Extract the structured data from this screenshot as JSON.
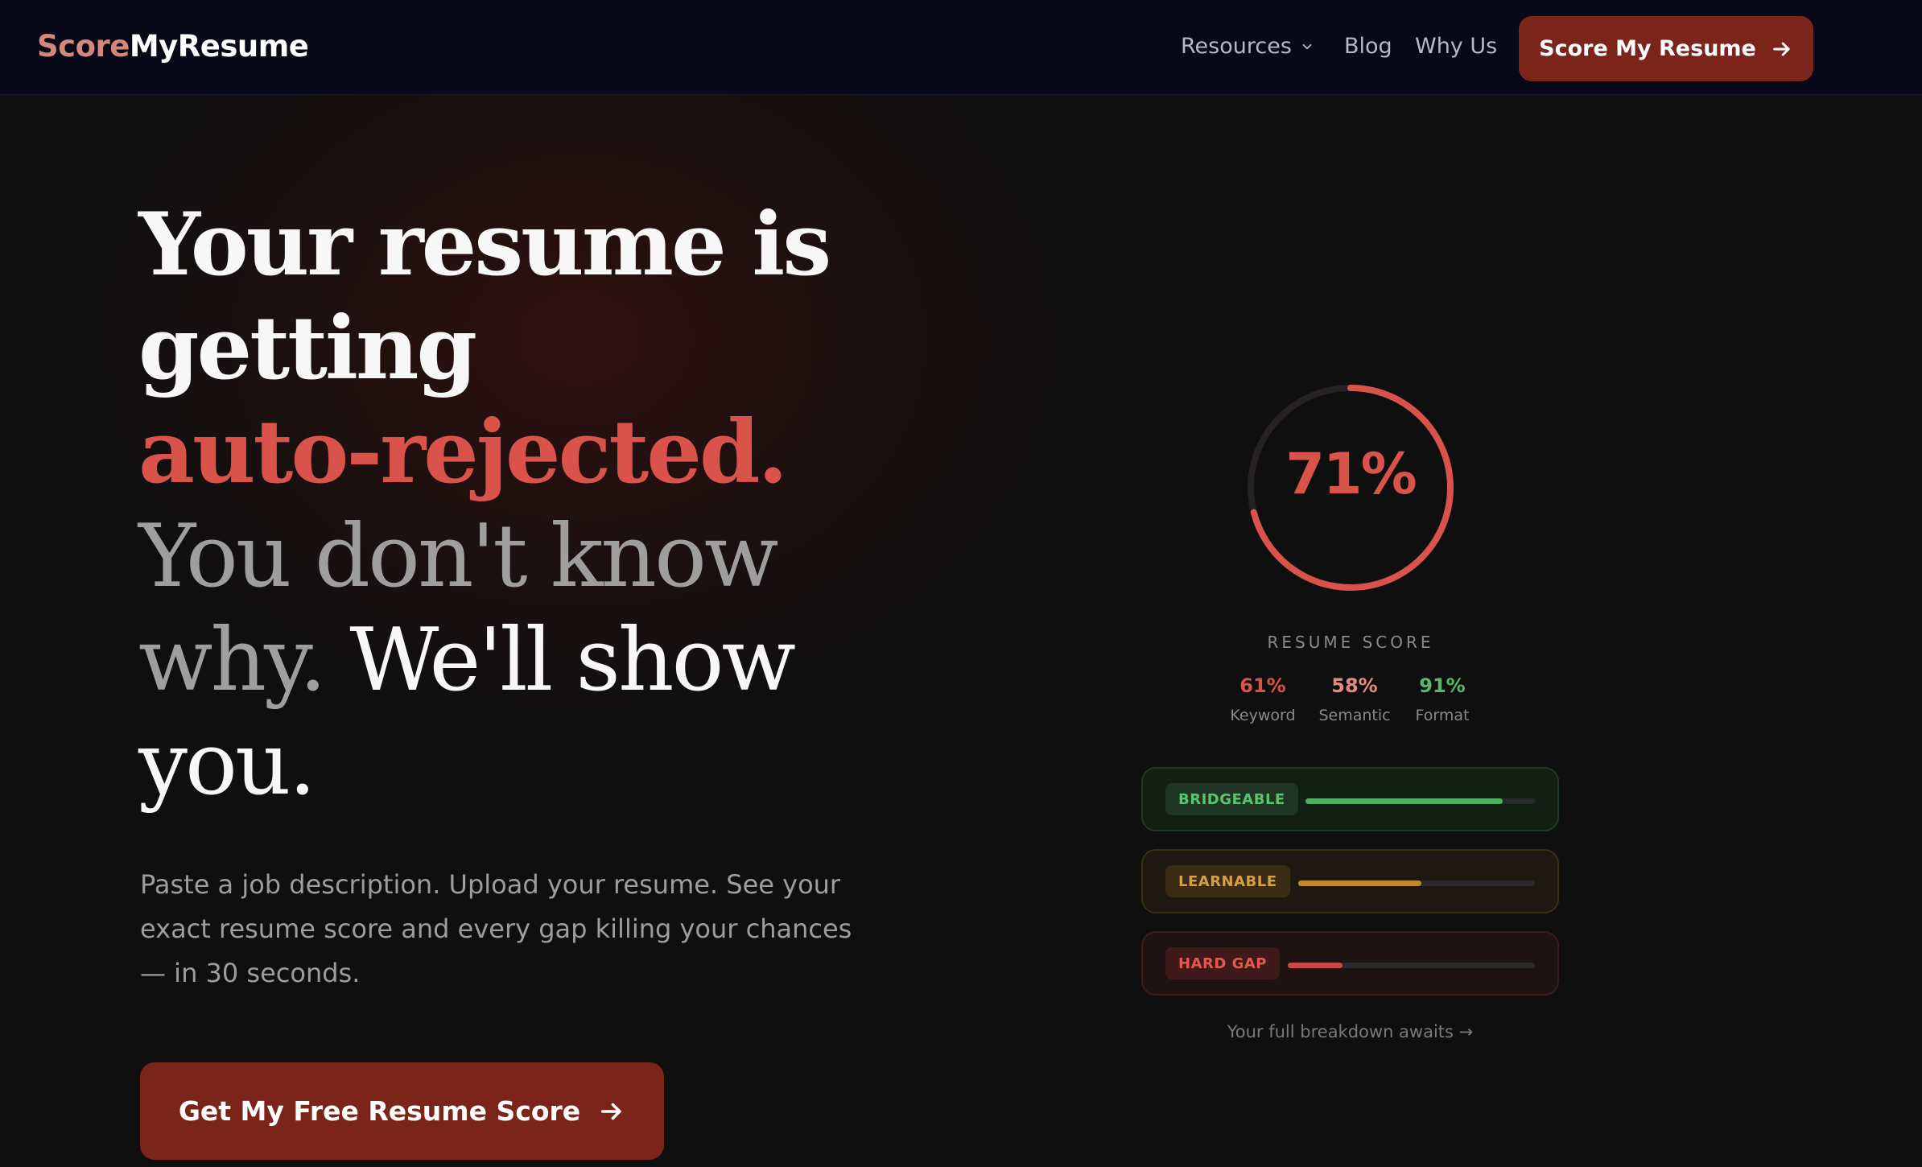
{
  "nav": {
    "logo_part1": "Score",
    "logo_part2": "MyResume",
    "links": [
      {
        "label": "Resources"
      },
      {
        "label": "Blog"
      },
      {
        "label": "Why Us"
      }
    ],
    "cta_label": "Score My Resume"
  },
  "hero": {
    "line1": "Your resume is",
    "line2": "getting",
    "line3": "auto-rejected.",
    "line4a": "You don't know",
    "line4b": "why.",
    "line5a": "We'll show",
    "line6": "you.",
    "subtitle": "Paste a job description. Upload your resume. See your exact resume score and every gap killing your chances — in 30 seconds.",
    "cta_label": "Get My Free Resume Score"
  },
  "score": {
    "overall": 71,
    "overall_label": "71%",
    "label": "RESUME SCORE",
    "metrics": [
      {
        "value": "61%",
        "name": "Keyword"
      },
      {
        "value": "58%",
        "name": "Semantic"
      },
      {
        "value": "91%",
        "name": "Format"
      }
    ],
    "gaps": [
      {
        "tag": "BRIDGEABLE",
        "level": 0.86
      },
      {
        "tag": "LEARNABLE",
        "level": 0.52
      },
      {
        "tag": "HARD GAP",
        "level": 0.22
      }
    ],
    "breakdown_link": "Your full breakdown awaits →"
  },
  "colors": {
    "accent": "#d9534a",
    "cta": "#7b2419",
    "nav_bg": "#070818",
    "green": "#4caf5f",
    "amber": "#c2882e"
  }
}
